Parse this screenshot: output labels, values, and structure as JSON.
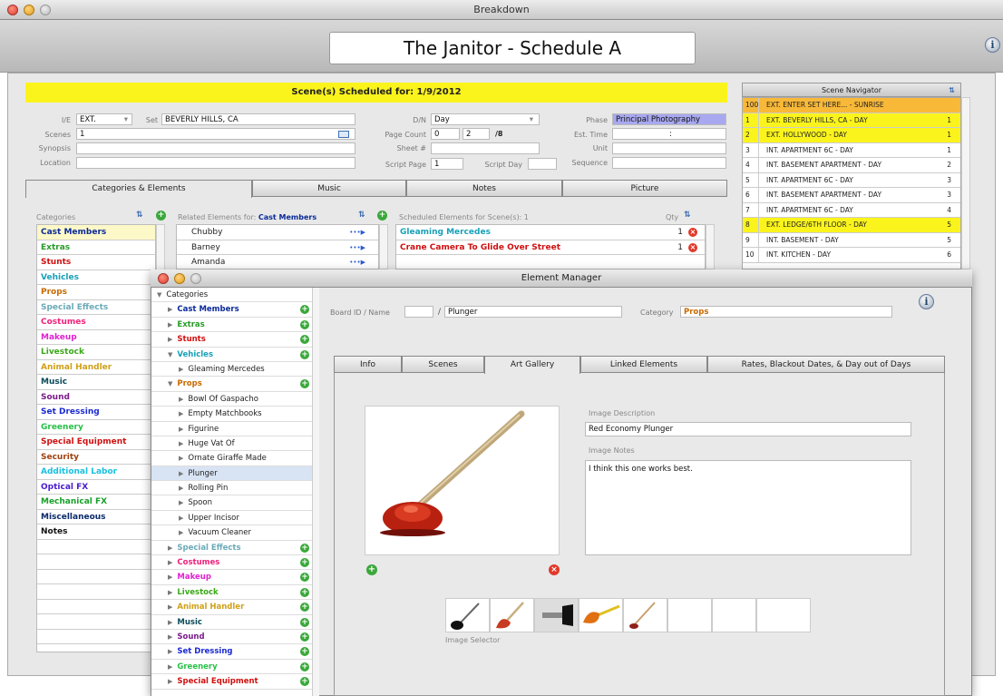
{
  "window": {
    "title": "Breakdown"
  },
  "header": {
    "title": "The Janitor - Schedule A"
  },
  "scheduled_banner": "Scene(s) Scheduled for: 1/9/2012",
  "fields": {
    "ie_label": "I/E",
    "ie_value": "EXT.",
    "set_label": "Set",
    "set_value": "BEVERLY HILLS, CA",
    "scenes_label": "Scenes",
    "scenes_value": "1",
    "synopsis_label": "Synopsis",
    "location_label": "Location",
    "dn_label": "D/N",
    "dn_value": "Day",
    "page_count_label": "Page Count",
    "page_count_a": "0",
    "page_count_b": "2",
    "page_count_unit": "/8",
    "sheet_label": "Sheet #",
    "script_page_label": "Script Page",
    "script_page_value": "1",
    "script_day_label": "Script Day",
    "phase_label": "Phase",
    "phase_value": "Principal Photography",
    "est_time_label": "Est. Time",
    "est_time_value": ":",
    "unit_label": "Unit",
    "sequence_label": "Sequence"
  },
  "tabs": [
    "Categories & Elements",
    "Music",
    "Notes",
    "Picture"
  ],
  "categories_header": "Categories",
  "categories": [
    {
      "label": "Cast Members",
      "color": "#0a2a9a"
    },
    {
      "label": "Extras",
      "color": "#2a9a2a"
    },
    {
      "label": "Stunts",
      "color": "#d01010"
    },
    {
      "label": "Vehicles",
      "color": "#18a0b8"
    },
    {
      "label": "Props",
      "color": "#c86a00"
    },
    {
      "label": "Special Effects",
      "color": "#6aaab8"
    },
    {
      "label": "Costumes",
      "color": "#f0207a"
    },
    {
      "label": "Makeup",
      "color": "#e020d0"
    },
    {
      "label": "Livestock",
      "color": "#3aa818"
    },
    {
      "label": "Animal Handler",
      "color": "#d0a018"
    },
    {
      "label": "Music",
      "color": "#0a4a5a"
    },
    {
      "label": "Sound",
      "color": "#7a1a8a"
    },
    {
      "label": "Set Dressing",
      "color": "#1a2ad0"
    },
    {
      "label": "Greenery",
      "color": "#28c048"
    },
    {
      "label": "Special Equipment",
      "color": "#d01010"
    },
    {
      "label": "Security",
      "color": "#a04010"
    },
    {
      "label": "Additional Labor",
      "color": "#18c0e0"
    },
    {
      "label": "Optical FX",
      "color": "#4a1ad0"
    },
    {
      "label": "Mechanical FX",
      "color": "#18a028"
    },
    {
      "label": "Miscellaneous",
      "color": "#0a2a6a"
    },
    {
      "label": "Notes",
      "color": "#111111"
    }
  ],
  "related": {
    "header_prefix": "Related Elements for:",
    "header_category": "Cast Members",
    "items": [
      "Chubby",
      "Barney",
      "Amanda"
    ]
  },
  "scheduled": {
    "header": "Scheduled Elements for Scene(s): 1",
    "qty_label": "Qty",
    "items": [
      {
        "label": "Gleaming Mercedes",
        "qty": "1",
        "color": "#18a0b8"
      },
      {
        "label": "Crane Camera To Glide Over Street",
        "qty": "1",
        "color": "#d01010"
      }
    ]
  },
  "navigator": {
    "title": "Scene Navigator",
    "rows": [
      {
        "n": "100",
        "t": "EXT. ENTER SET HERE... - SUNRISE",
        "c": "",
        "bg": "#f8b838"
      },
      {
        "n": "1",
        "t": "EXT. BEVERLY HILLS, CA  - DAY",
        "c": "1",
        "bg": "#fbf41c"
      },
      {
        "n": "2",
        "t": "EXT. HOLLYWOOD  - DAY",
        "c": "1",
        "bg": "#fbf41c"
      },
      {
        "n": "3",
        "t": "INT. APARTMENT 6C  - DAY",
        "c": "1",
        "bg": "#ffffff"
      },
      {
        "n": "4",
        "t": "INT. BASEMENT APARTMENT  - DAY",
        "c": "2",
        "bg": "#ffffff"
      },
      {
        "n": "5",
        "t": "INT. APARTMENT 6C  - DAY",
        "c": "3",
        "bg": "#ffffff"
      },
      {
        "n": "6",
        "t": "INT. BASEMENT APARTMENT  - DAY",
        "c": "3",
        "bg": "#ffffff"
      },
      {
        "n": "7",
        "t": "INT. APARTMENT 6C  - DAY",
        "c": "4",
        "bg": "#ffffff"
      },
      {
        "n": "8",
        "t": "EXT. LEDGE/6TH FLOOR  - DAY",
        "c": "5",
        "bg": "#fbf41c"
      },
      {
        "n": "9",
        "t": "INT. BASEMENT  - DAY",
        "c": "5",
        "bg": "#ffffff"
      },
      {
        "n": "10",
        "t": "INT. KITCHEN  - DAY",
        "c": "6",
        "bg": "#ffffff"
      }
    ]
  },
  "element_manager": {
    "title": "Element Manager",
    "board_label": "Board ID / Name",
    "slash": "/",
    "name_value": "Plunger",
    "category_label": "Category",
    "category_value": "Props",
    "tabs": [
      "Info",
      "Scenes",
      "Art Gallery",
      "Linked Elements",
      "Rates, Blackout Dates, & Day out of Days"
    ],
    "image_description_label": "Image Description",
    "image_description": "Red Economy Plunger",
    "image_notes_label": "Image Notes",
    "image_notes": "I think this one works best.",
    "image_selector_label": "Image Selector",
    "tree": [
      {
        "label": "Categories",
        "level": 0,
        "arrow": "▼",
        "color": "#222",
        "bold": false,
        "plus": false
      },
      {
        "label": "Cast Members",
        "level": 1,
        "arrow": "▶",
        "color": "#0a2a9a",
        "bold": true,
        "plus": true
      },
      {
        "label": "Extras",
        "level": 1,
        "arrow": "▶",
        "color": "#2a9a2a",
        "bold": true,
        "plus": true
      },
      {
        "label": "Stunts",
        "level": 1,
        "arrow": "▶",
        "color": "#d01010",
        "bold": true,
        "plus": true
      },
      {
        "label": "Vehicles",
        "level": 1,
        "arrow": "▼",
        "color": "#18a0b8",
        "bold": true,
        "plus": true
      },
      {
        "label": "Gleaming Mercedes",
        "level": 2,
        "arrow": "▶",
        "color": "#222",
        "bold": false,
        "plus": false
      },
      {
        "label": "Props",
        "level": 1,
        "arrow": "▼",
        "color": "#c86a00",
        "bold": true,
        "plus": true
      },
      {
        "label": "Bowl Of Gaspacho",
        "level": 2,
        "arrow": "▶",
        "color": "#222",
        "bold": false,
        "plus": false
      },
      {
        "label": "Empty Matchbooks",
        "level": 2,
        "arrow": "▶",
        "color": "#222",
        "bold": false,
        "plus": false
      },
      {
        "label": "Figurine",
        "level": 2,
        "arrow": "▶",
        "color": "#222",
        "bold": false,
        "plus": false
      },
      {
        "label": "Huge Vat Of",
        "level": 2,
        "arrow": "▶",
        "color": "#222",
        "bold": false,
        "plus": false
      },
      {
        "label": "Ornate Giraffe Made",
        "level": 2,
        "arrow": "▶",
        "color": "#222",
        "bold": false,
        "plus": false
      },
      {
        "label": "Plunger",
        "level": 2,
        "arrow": "▶",
        "color": "#222",
        "bold": false,
        "plus": false,
        "selected": true
      },
      {
        "label": "Rolling Pin",
        "level": 2,
        "arrow": "▶",
        "color": "#222",
        "bold": false,
        "plus": false
      },
      {
        "label": "Spoon",
        "level": 2,
        "arrow": "▶",
        "color": "#222",
        "bold": false,
        "plus": false
      },
      {
        "label": "Upper Incisor",
        "level": 2,
        "arrow": "▶",
        "color": "#222",
        "bold": false,
        "plus": false
      },
      {
        "label": "Vacuum Cleaner",
        "level": 2,
        "arrow": "▶",
        "color": "#222",
        "bold": false,
        "plus": false
      },
      {
        "label": "Special Effects",
        "level": 1,
        "arrow": "▶",
        "color": "#6aaab8",
        "bold": true,
        "plus": true
      },
      {
        "label": "Costumes",
        "level": 1,
        "arrow": "▶",
        "color": "#f0207a",
        "bold": true,
        "plus": true
      },
      {
        "label": "Makeup",
        "level": 1,
        "arrow": "▶",
        "color": "#e020d0",
        "bold": true,
        "plus": true
      },
      {
        "label": "Livestock",
        "level": 1,
        "arrow": "▶",
        "color": "#3aa818",
        "bold": true,
        "plus": true
      },
      {
        "label": "Animal Handler",
        "level": 1,
        "arrow": "▶",
        "color": "#d0a018",
        "bold": true,
        "plus": true
      },
      {
        "label": "Music",
        "level": 1,
        "arrow": "▶",
        "color": "#0a4a5a",
        "bold": true,
        "plus": true
      },
      {
        "label": "Sound",
        "level": 1,
        "arrow": "▶",
        "color": "#7a1a8a",
        "bold": true,
        "plus": true
      },
      {
        "label": "Set Dressing",
        "level": 1,
        "arrow": "▶",
        "color": "#1a2ad0",
        "bold": true,
        "plus": true
      },
      {
        "label": "Greenery",
        "level": 1,
        "arrow": "▶",
        "color": "#28c048",
        "bold": true,
        "plus": true
      },
      {
        "label": "Special Equipment",
        "level": 1,
        "arrow": "▶",
        "color": "#d01010",
        "bold": true,
        "plus": true
      }
    ]
  }
}
